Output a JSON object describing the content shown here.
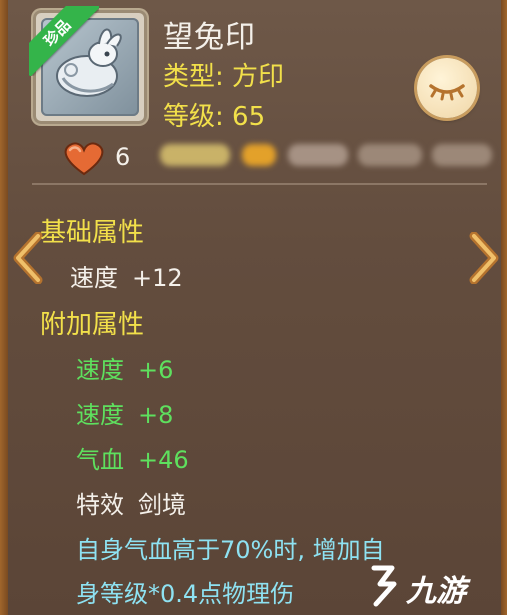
{
  "item": {
    "name": "望兔印",
    "rarity_badge": "珍品",
    "type": "类型: 方印",
    "level": "等级: 65",
    "hearts": "6"
  },
  "base_section": {
    "title": "基础属性",
    "stats": [
      {
        "label": "速度",
        "value": "+12"
      }
    ]
  },
  "extra_section": {
    "title": "附加属性",
    "stats": [
      {
        "label": "速度",
        "value": "+6"
      },
      {
        "label": "速度",
        "value": "+8"
      },
      {
        "label": "气血",
        "value": "+46"
      }
    ],
    "effect_label": "特效",
    "effect_value": "剑境",
    "effect_desc_line1": "自身气血高于70%时, 增加自",
    "effect_desc_line2": "身等级*0.4点物理伤"
  },
  "watermark": {
    "text": "九游"
  },
  "icons": {
    "eye": "eye-closed-icon",
    "heart": "heart-icon",
    "prev": "chevron-left-icon",
    "next": "chevron-right-icon"
  },
  "colors": {
    "title_yellow": "#f2e04a",
    "bonus_green": "#5ee05e",
    "effect_blue": "#8ee2f2",
    "badge_green": "#34b44a"
  }
}
